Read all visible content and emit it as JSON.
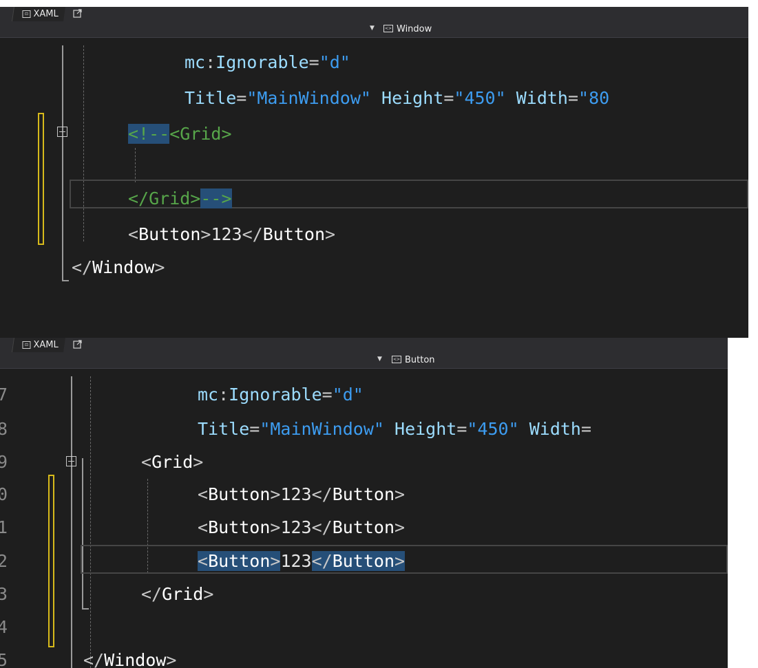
{
  "top": {
    "tab_label": "XAML",
    "nav_label": "Window",
    "lines": [
      [
        {
          "t": "mc",
          "c": "c-attr"
        },
        {
          "t": ":",
          "c": "c-punc"
        },
        {
          "t": "Ignorable",
          "c": "c-attr"
        },
        {
          "t": "=",
          "c": "c-punc"
        },
        {
          "t": "\"d\"",
          "c": "c-val"
        }
      ],
      [
        {
          "t": "Title",
          "c": "c-attr"
        },
        {
          "t": "=",
          "c": "c-punc"
        },
        {
          "t": "\"MainWindow\"",
          "c": "c-val"
        },
        {
          "t": " ",
          "c": "c-text"
        },
        {
          "t": "Height",
          "c": "c-attr"
        },
        {
          "t": "=",
          "c": "c-punc"
        },
        {
          "t": "\"450\"",
          "c": "c-val"
        },
        {
          "t": " ",
          "c": "c-text"
        },
        {
          "t": "Width",
          "c": "c-attr"
        },
        {
          "t": "=",
          "c": "c-punc"
        },
        {
          "t": "\"80",
          "c": "c-val"
        }
      ],
      [
        {
          "t": "<!--",
          "c": "c-comment",
          "hl": true
        },
        {
          "t": "<Grid>",
          "c": "c-comment"
        }
      ],
      [],
      [
        {
          "t": "</Grid>",
          "c": "c-comment"
        },
        {
          "t": "-->",
          "c": "c-comment",
          "hl": true
        }
      ],
      [
        {
          "t": "<",
          "c": "c-punc"
        },
        {
          "t": "Button",
          "c": "c-tag"
        },
        {
          "t": ">",
          "c": "c-punc"
        },
        {
          "t": "123",
          "c": "c-text"
        },
        {
          "t": "</",
          "c": "c-punc"
        },
        {
          "t": "Button",
          "c": "c-tag"
        },
        {
          "t": ">",
          "c": "c-punc"
        }
      ],
      [
        {
          "t": "</",
          "c": "c-punc"
        },
        {
          "t": "Window",
          "c": "c-tag"
        },
        {
          "t": ">",
          "c": "c-punc"
        }
      ]
    ]
  },
  "bottom": {
    "tab_label": "XAML",
    "nav_label": "Button",
    "line_numbers": [
      "7",
      "8",
      "9",
      "0",
      "1",
      "2",
      "3",
      "4",
      "5"
    ],
    "lines": [
      [
        {
          "t": "mc",
          "c": "c-attr"
        },
        {
          "t": ":",
          "c": "c-punc"
        },
        {
          "t": "Ignorable",
          "c": "c-attr"
        },
        {
          "t": "=",
          "c": "c-punc"
        },
        {
          "t": "\"d\"",
          "c": "c-val"
        }
      ],
      [
        {
          "t": "Title",
          "c": "c-attr"
        },
        {
          "t": "=",
          "c": "c-punc"
        },
        {
          "t": "\"MainWindow\"",
          "c": "c-val"
        },
        {
          "t": " ",
          "c": "c-text"
        },
        {
          "t": "Height",
          "c": "c-attr"
        },
        {
          "t": "=",
          "c": "c-punc"
        },
        {
          "t": "\"450\"",
          "c": "c-val"
        },
        {
          "t": " ",
          "c": "c-text"
        },
        {
          "t": "Width",
          "c": "c-attr"
        },
        {
          "t": "=",
          "c": "c-punc"
        }
      ],
      [
        {
          "t": "<",
          "c": "c-punc"
        },
        {
          "t": "Grid",
          "c": "c-tag"
        },
        {
          "t": ">",
          "c": "c-punc"
        }
      ],
      [
        {
          "t": "<",
          "c": "c-punc"
        },
        {
          "t": "Button",
          "c": "c-tag"
        },
        {
          "t": ">",
          "c": "c-punc"
        },
        {
          "t": "123",
          "c": "c-text"
        },
        {
          "t": "</",
          "c": "c-punc"
        },
        {
          "t": "Button",
          "c": "c-tag"
        },
        {
          "t": ">",
          "c": "c-punc"
        }
      ],
      [
        {
          "t": "<",
          "c": "c-punc"
        },
        {
          "t": "Button",
          "c": "c-tag"
        },
        {
          "t": ">",
          "c": "c-punc"
        },
        {
          "t": "123",
          "c": "c-text"
        },
        {
          "t": "</",
          "c": "c-punc"
        },
        {
          "t": "Button",
          "c": "c-tag"
        },
        {
          "t": ">",
          "c": "c-punc"
        }
      ],
      [
        {
          "t": "<",
          "c": "c-punc",
          "hl": true
        },
        {
          "t": "Button",
          "c": "c-tag",
          "hl": true
        },
        {
          "t": ">",
          "c": "c-punc",
          "hl": true
        },
        {
          "t": "123",
          "c": "c-text"
        },
        {
          "t": "</",
          "c": "c-punc",
          "hl": true
        },
        {
          "t": "Button",
          "c": "c-tag",
          "hl": true
        },
        {
          "t": ">",
          "c": "c-punc",
          "hl": true
        }
      ],
      [
        {
          "t": "</",
          "c": "c-punc"
        },
        {
          "t": "Grid",
          "c": "c-tag"
        },
        {
          "t": ">",
          "c": "c-punc"
        }
      ],
      [],
      [
        {
          "t": "</",
          "c": "c-punc"
        },
        {
          "t": "Window",
          "c": "c-tag"
        },
        {
          "t": ">",
          "c": "c-punc"
        }
      ]
    ]
  }
}
